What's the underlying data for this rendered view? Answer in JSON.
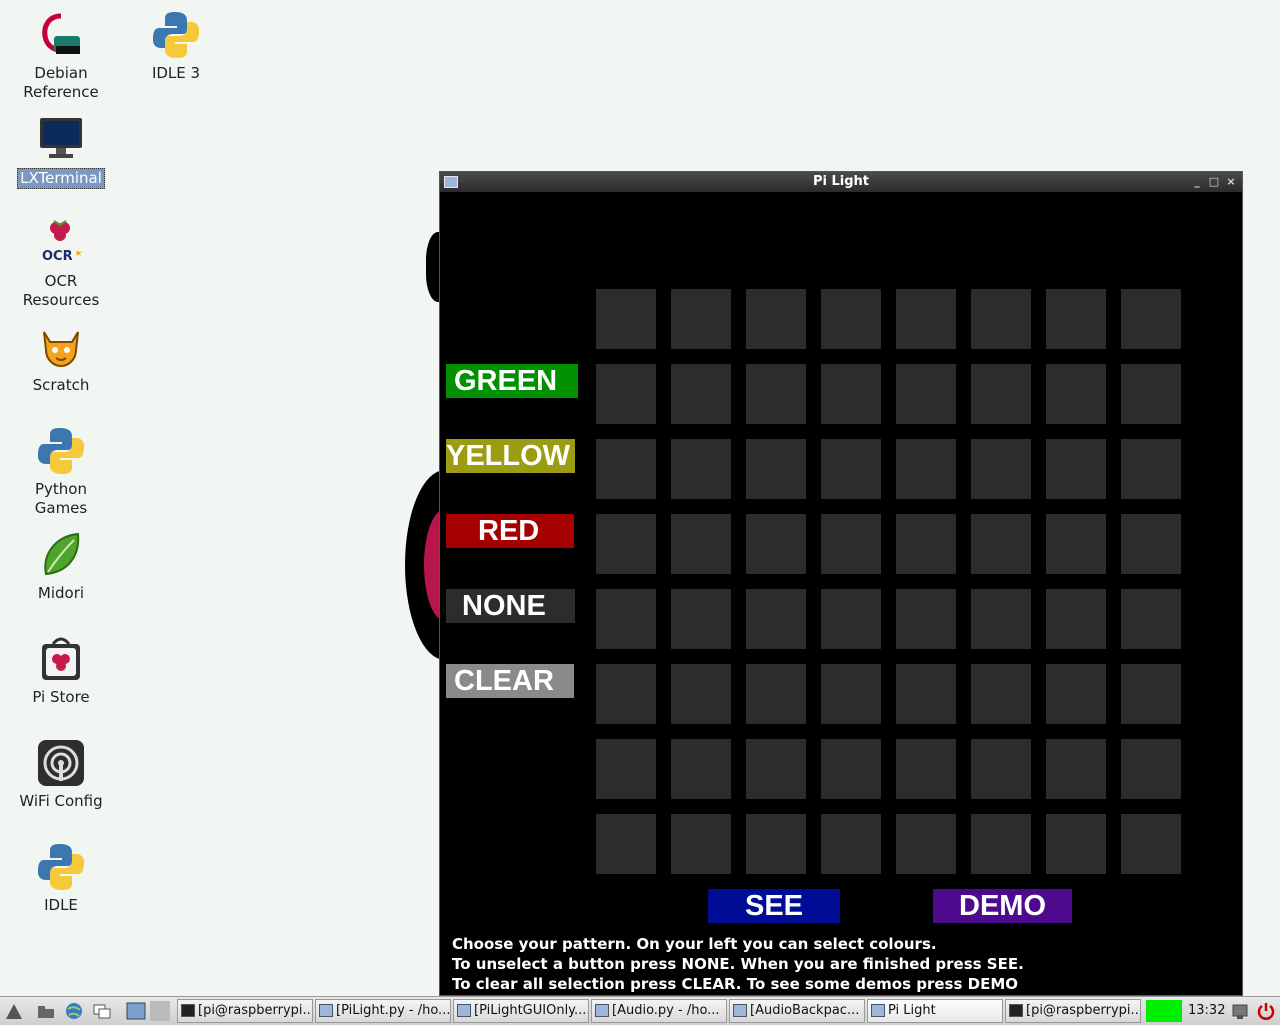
{
  "desktop": {
    "icons": [
      {
        "label": "Debian\nReference",
        "icon": "debian-swirl-icon"
      },
      {
        "label": "IDLE 3",
        "icon": "python-icon"
      },
      {
        "label": "LXTerminal",
        "icon": "monitor-icon"
      },
      {
        "label": "OCR\nResources",
        "icon": "ocr-raspberry-icon",
        "badge": "OCR"
      },
      {
        "label": "Scratch",
        "icon": "scratch-cat-icon"
      },
      {
        "label": "Python\nGames",
        "icon": "python-icon"
      },
      {
        "label": "Midori",
        "icon": "midori-leaf-icon"
      },
      {
        "label": "Pi Store",
        "icon": "pi-store-bag-icon"
      },
      {
        "label": "WiFi Config",
        "icon": "wifi-icon"
      },
      {
        "label": "IDLE",
        "icon": "python-icon"
      }
    ]
  },
  "window": {
    "title": "Pi Light",
    "controls": {
      "minimize": "_",
      "maximize": "□",
      "close": "×"
    },
    "color_buttons": [
      {
        "label": "GREEN",
        "color": "#009000"
      },
      {
        "label": "YELLOW",
        "color": "#9c9c12"
      },
      {
        "label": "RED",
        "color": "#a50000"
      },
      {
        "label": "NONE",
        "color": "#2c2c2c"
      },
      {
        "label": "CLEAR",
        "color": "#8a8a8a"
      }
    ],
    "grid": {
      "rows": 8,
      "cols": 8,
      "cell_color": "#2c2c2c"
    },
    "see_button": {
      "label": "SEE",
      "color": "#000c96"
    },
    "demo_button": {
      "label": "DEMO",
      "color": "#4d0a8c"
    },
    "instructions": [
      "Choose your pattern. On your left you can select colours.",
      "To unselect a button press NONE. When you are finished press SEE.",
      "To clear all selection press CLEAR. To see some demos press DEMO"
    ]
  },
  "taskbar": {
    "tasks": [
      {
        "label": "[pi@raspberrypi...",
        "type": "term"
      },
      {
        "label": "[PiLight.py - /ho...",
        "type": "win"
      },
      {
        "label": "[PiLightGUIOnly....",
        "type": "win"
      },
      {
        "label": "[Audio.py - /ho...",
        "type": "win"
      },
      {
        "label": "[AudioBackpac...",
        "type": "win"
      },
      {
        "label": "Pi Light",
        "type": "win"
      },
      {
        "label": "[pi@raspberrypi...",
        "type": "term"
      }
    ],
    "cpu_color": "#00ee00",
    "clock": "13:32"
  }
}
